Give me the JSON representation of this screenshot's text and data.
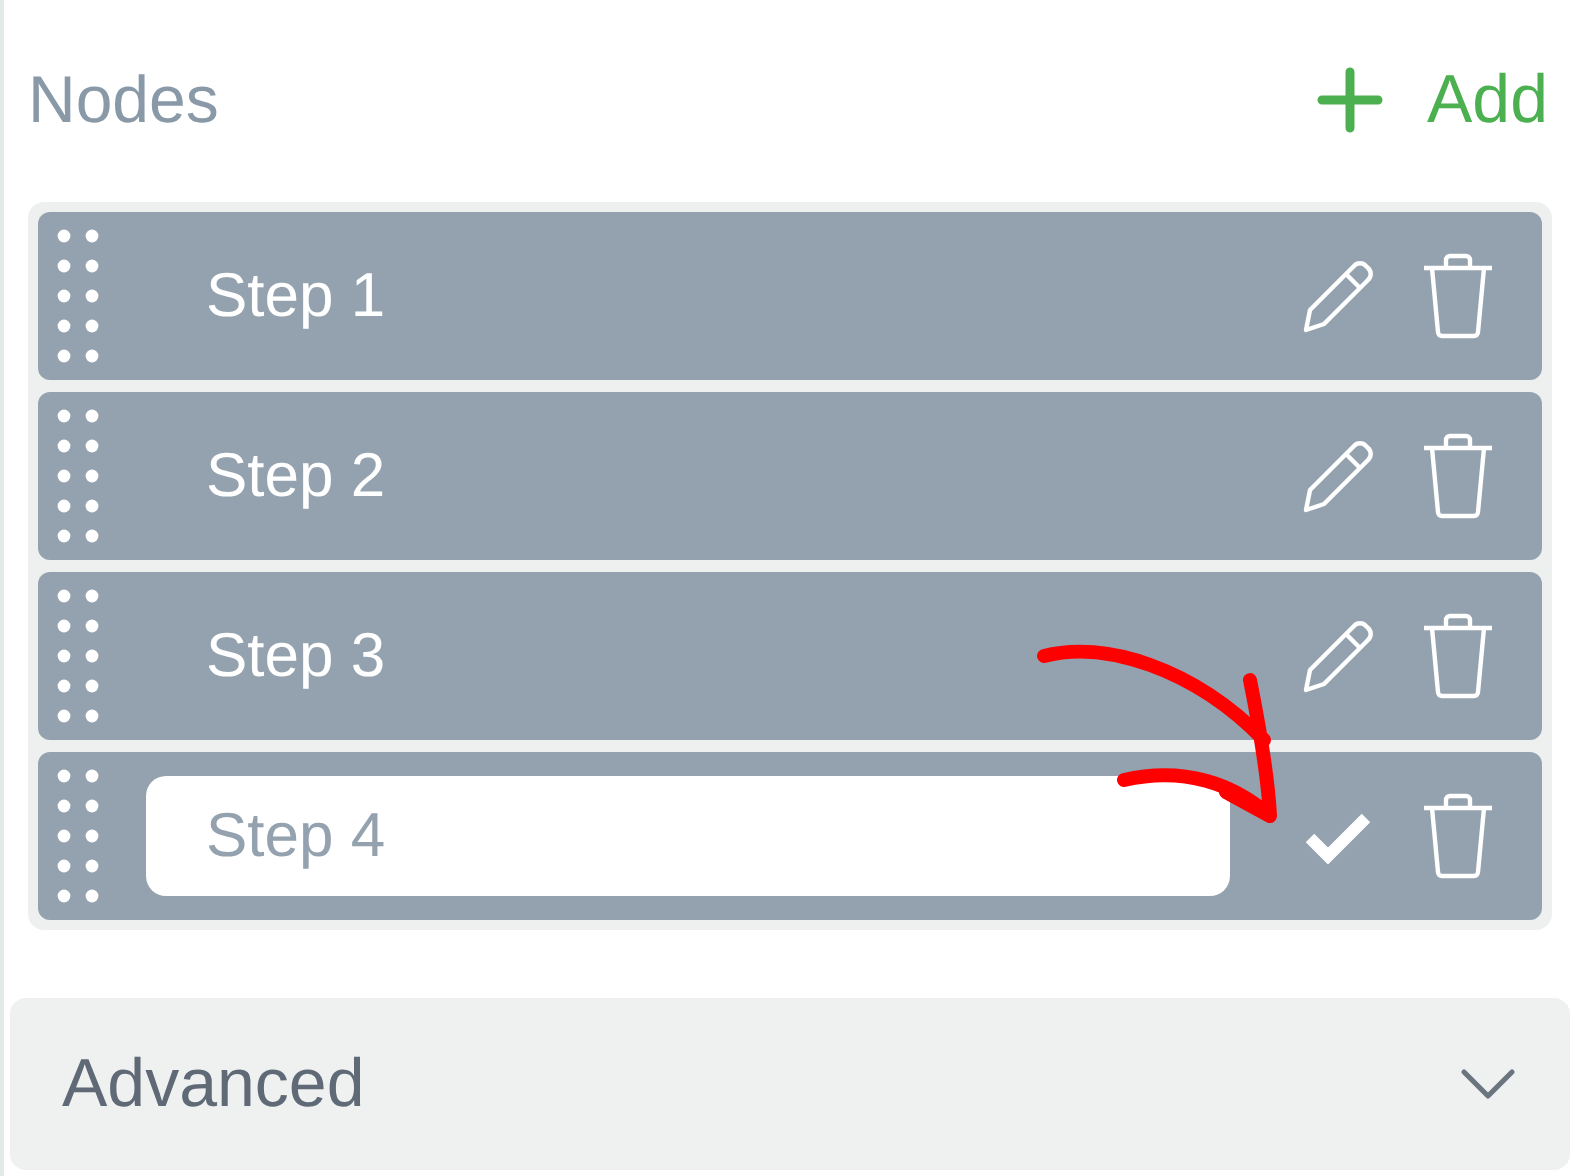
{
  "header": {
    "title": "Nodes",
    "add_label": "Add"
  },
  "nodes": [
    {
      "label": "Step 1",
      "editing": false
    },
    {
      "label": "Step 2",
      "editing": false
    },
    {
      "label": "Step 3",
      "editing": false
    },
    {
      "label": "Step 4",
      "editing": true
    }
  ],
  "advanced": {
    "title": "Advanced",
    "expanded": false
  }
}
